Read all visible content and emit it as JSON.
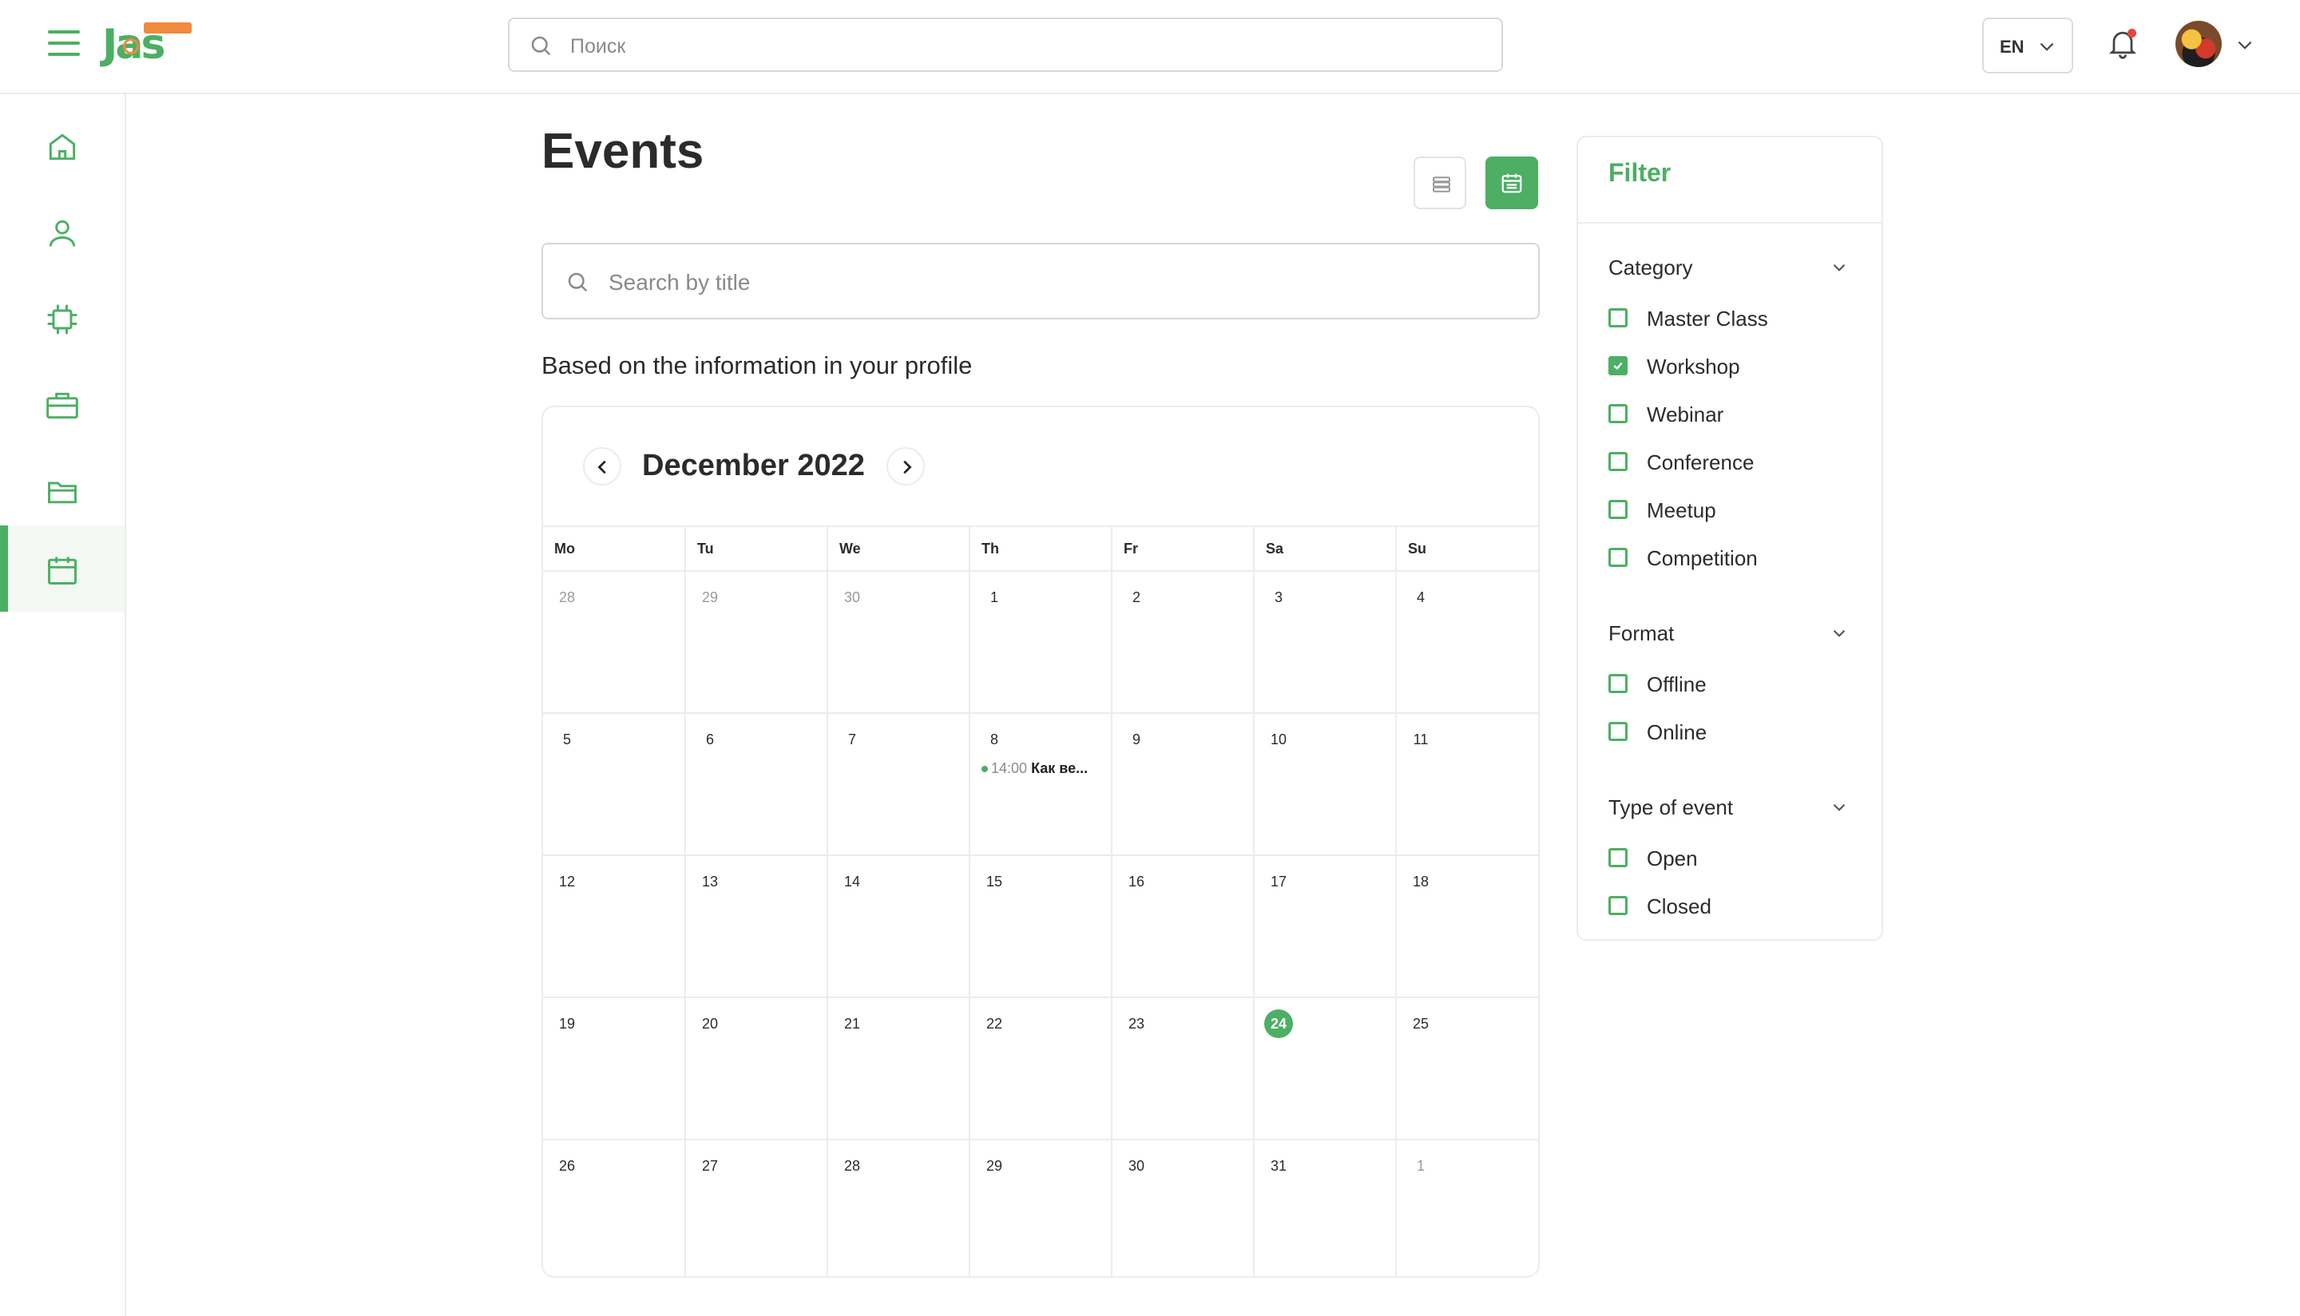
{
  "header": {
    "logo_text": "Jas",
    "search_placeholder": "Поиск",
    "language": "EN"
  },
  "sidebar": {
    "items": [
      {
        "name": "home",
        "icon": "home-icon"
      },
      {
        "name": "profile",
        "icon": "user-icon"
      },
      {
        "name": "chip",
        "icon": "chip-icon"
      },
      {
        "name": "jobs",
        "icon": "briefcase-icon"
      },
      {
        "name": "files",
        "icon": "folder-icon"
      },
      {
        "name": "events",
        "icon": "calendar-icon",
        "active": true
      }
    ]
  },
  "main": {
    "title": "Events",
    "search_placeholder": "Search by title",
    "profile_note": "Based on the information in your profile",
    "active_view": "calendar"
  },
  "calendar": {
    "month_title": "December 2022",
    "weekdays": [
      "Mo",
      "Tu",
      "We",
      "Th",
      "Fr",
      "Sa",
      "Su"
    ],
    "weeks": [
      [
        {
          "d": "28",
          "muted": true
        },
        {
          "d": "29",
          "muted": true
        },
        {
          "d": "30",
          "muted": true
        },
        {
          "d": "1"
        },
        {
          "d": "2"
        },
        {
          "d": "3"
        },
        {
          "d": "4"
        }
      ],
      [
        {
          "d": "5"
        },
        {
          "d": "6"
        },
        {
          "d": "7"
        },
        {
          "d": "8",
          "event": {
            "time": "14:00",
            "title": "Как ве..."
          }
        },
        {
          "d": "9"
        },
        {
          "d": "10"
        },
        {
          "d": "11"
        }
      ],
      [
        {
          "d": "12"
        },
        {
          "d": "13"
        },
        {
          "d": "14"
        },
        {
          "d": "15"
        },
        {
          "d": "16"
        },
        {
          "d": "17"
        },
        {
          "d": "18"
        }
      ],
      [
        {
          "d": "19"
        },
        {
          "d": "20"
        },
        {
          "d": "21"
        },
        {
          "d": "22"
        },
        {
          "d": "23"
        },
        {
          "d": "24",
          "today": true
        },
        {
          "d": "25"
        }
      ],
      [
        {
          "d": "26"
        },
        {
          "d": "27"
        },
        {
          "d": "28"
        },
        {
          "d": "29"
        },
        {
          "d": "30"
        },
        {
          "d": "31"
        },
        {
          "d": "1",
          "muted": true
        }
      ]
    ]
  },
  "filter": {
    "title": "Filter",
    "groups": [
      {
        "label": "Category",
        "options": [
          {
            "label": "Master Class",
            "checked": false
          },
          {
            "label": "Workshop",
            "checked": true
          },
          {
            "label": "Webinar",
            "checked": false
          },
          {
            "label": "Conference",
            "checked": false
          },
          {
            "label": "Meetup",
            "checked": false
          },
          {
            "label": "Competition",
            "checked": false
          }
        ]
      },
      {
        "label": "Format",
        "options": [
          {
            "label": "Offline",
            "checked": false
          },
          {
            "label": "Online",
            "checked": false
          }
        ]
      },
      {
        "label": "Type of event",
        "options": [
          {
            "label": "Open",
            "checked": false
          },
          {
            "label": "Closed",
            "checked": false
          }
        ]
      }
    ]
  },
  "colors": {
    "accent": "#4caf63",
    "brand_orange": "#f08a3c",
    "notification_dot": "#e8453c",
    "border": "#ececec"
  }
}
